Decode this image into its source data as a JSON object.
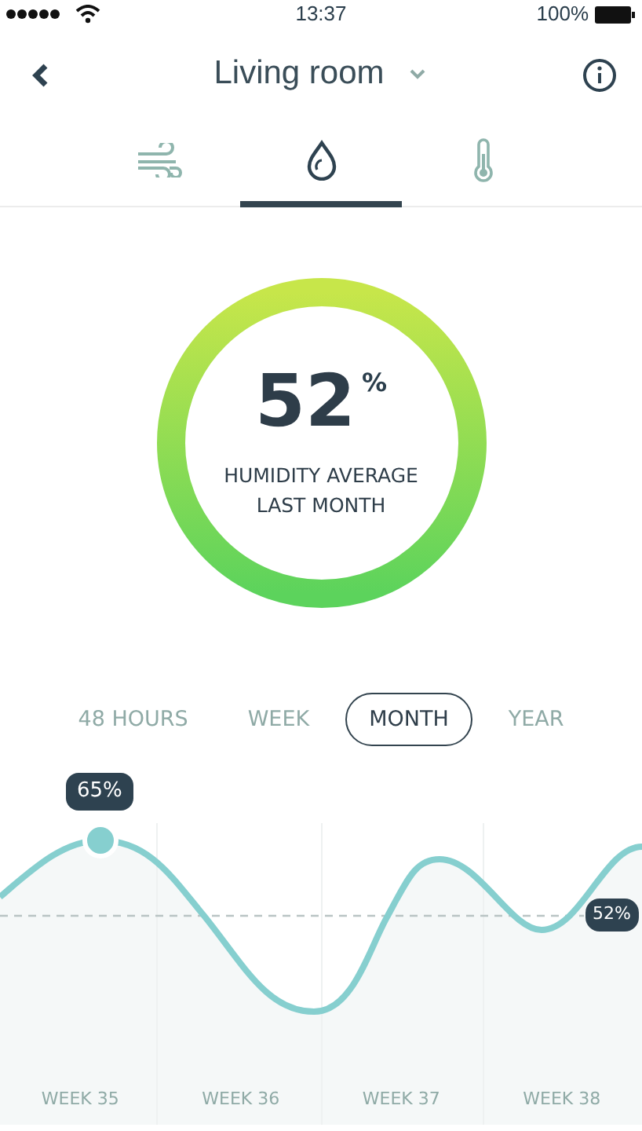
{
  "status_bar": {
    "time": "13:37",
    "battery": "100%"
  },
  "header": {
    "title": "Living room"
  },
  "tabs": [
    {
      "kind": "wind",
      "selected": false
    },
    {
      "kind": "drop",
      "selected": true
    },
    {
      "kind": "thermometer",
      "selected": false
    }
  ],
  "gauge": {
    "value": "52",
    "unit": "%",
    "caption": "HUMIDITY AVERAGE LAST MONTH"
  },
  "periods": [
    {
      "label": "48 HOURS",
      "selected": false
    },
    {
      "label": "WEEK",
      "selected": false
    },
    {
      "label": "MONTH",
      "selected": true
    },
    {
      "label": "YEAR",
      "selected": false
    }
  ],
  "chart": {
    "tooltip": "65%",
    "average_label": "52%",
    "weeks": [
      "WEEK 35",
      "WEEK 36",
      "WEEK 37",
      "WEEK 38"
    ]
  }
}
